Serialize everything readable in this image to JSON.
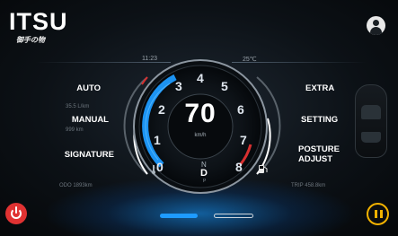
{
  "brand": {
    "name": "ITSU",
    "subtitle": "御手の物"
  },
  "status": {
    "time": "11:23",
    "temperature": "25℃"
  },
  "left_menu": [
    {
      "label": "AUTO"
    },
    {
      "label": "MANUAL"
    },
    {
      "label": "SIGNATURE"
    }
  ],
  "right_menu": [
    {
      "label": "EXTRA"
    },
    {
      "label": "SETTING"
    },
    {
      "label": "POSTURE\nADJUST"
    }
  ],
  "stats": {
    "left_1": "35.5 L/km",
    "left_2": "999 km",
    "bottom_left": "ODO 1893km",
    "bottom_right": "TRIP 458.8km"
  },
  "gauge": {
    "speed": "70",
    "unit": "km/h",
    "ticks": [
      "0",
      "1",
      "2",
      "3",
      "4",
      "5",
      "6",
      "7",
      "8"
    ],
    "gears": {
      "n": "N",
      "d": "D",
      "p": "P"
    }
  },
  "pager": {
    "pages": 2,
    "active": 0
  },
  "colors": {
    "accent": "#1e9bff",
    "power": "#e03232",
    "pause": "#f2b200",
    "redline": "#d83030"
  },
  "icons": {
    "user": "user-icon",
    "power": "power-icon",
    "pause": "pause-icon",
    "fuel": "fuel-icon",
    "temp": "temperature-icon"
  }
}
